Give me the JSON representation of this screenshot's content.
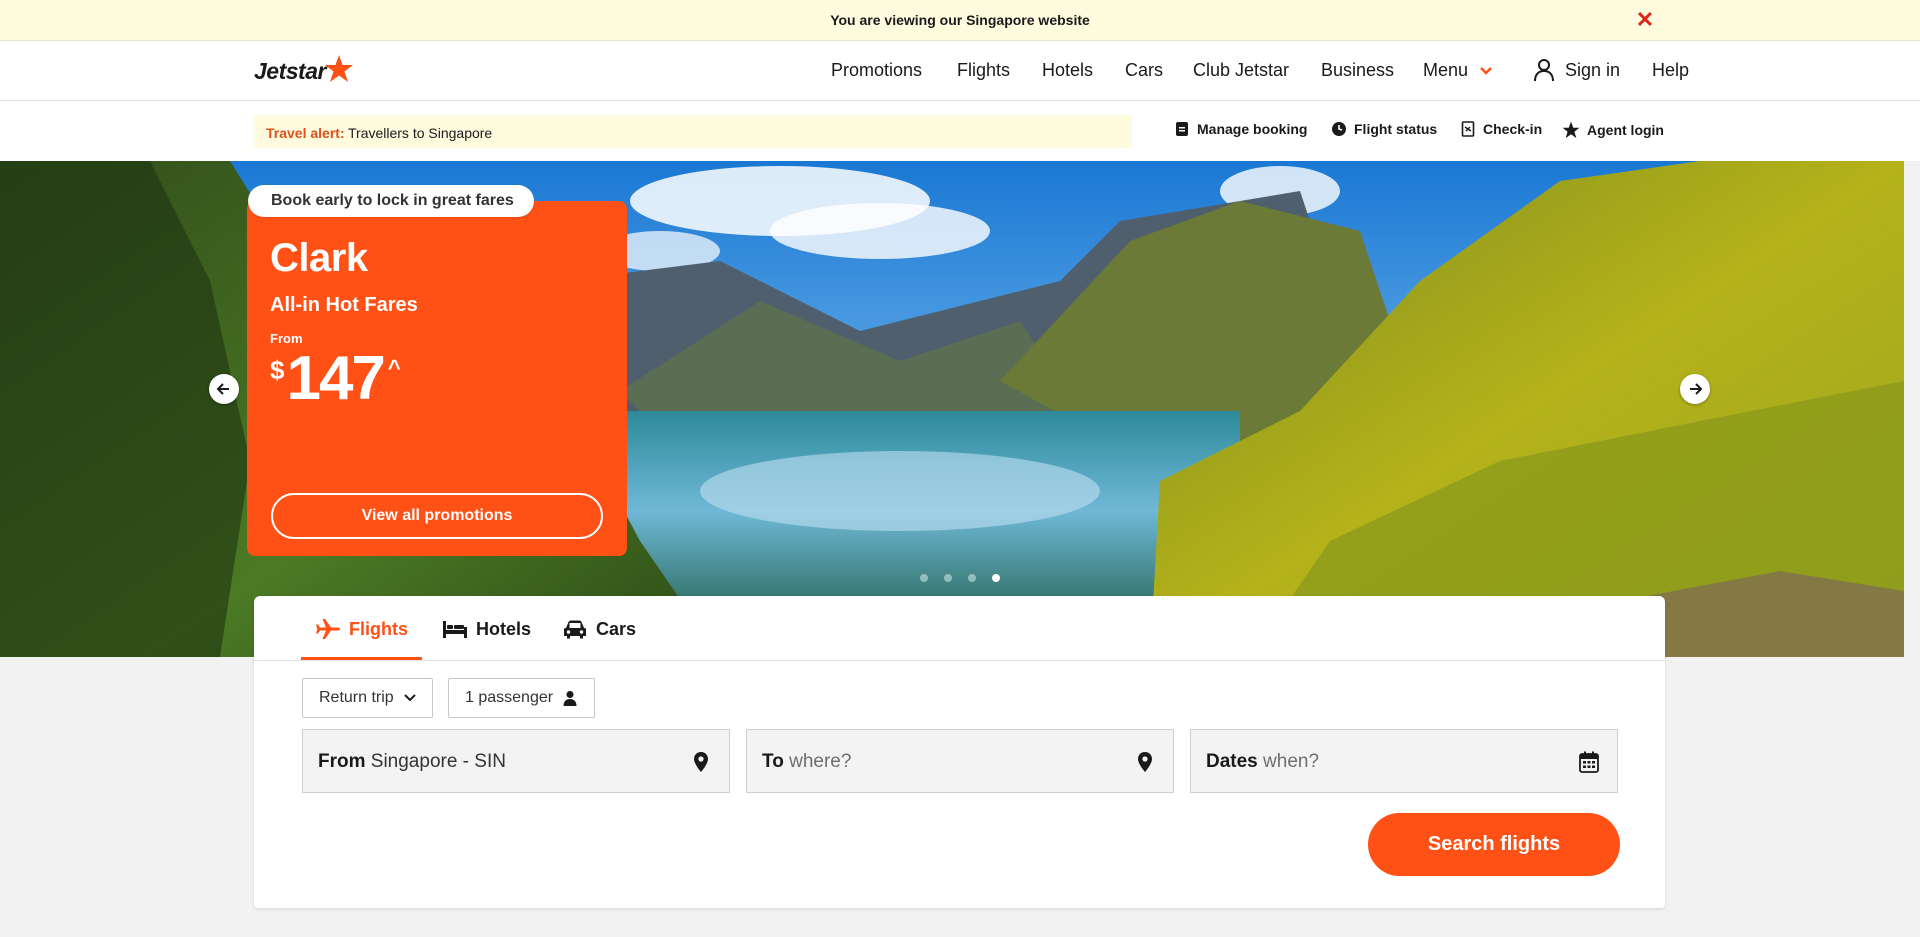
{
  "notice": {
    "text": "You are viewing our Singapore website",
    "close_icon": "close-icon",
    "close_color": "#e0241b"
  },
  "brand": {
    "name": "Jetstar",
    "accent": "#ff5115"
  },
  "nav": {
    "items": [
      "Promotions",
      "Flights",
      "Hotels",
      "Cars",
      "Club Jetstar",
      "Business",
      "Menu"
    ],
    "signin": "Sign in",
    "help": "Help"
  },
  "alert": {
    "label": "Travel alert:",
    "message": "Travellers to Singapore"
  },
  "utility_links": [
    {
      "label": "Manage booking",
      "icon": "document-icon"
    },
    {
      "label": "Flight status",
      "icon": "clock-icon"
    },
    {
      "label": "Check-in",
      "icon": "boarding-pass-icon"
    },
    {
      "label": "Agent login",
      "icon": "star-icon"
    }
  ],
  "hero": {
    "badge": "Book early to lock in great fares",
    "destination": "Clark",
    "subtitle": "All-in Hot Fares",
    "from_label": "From",
    "currency": "$",
    "price": "147",
    "price_suffix": "^",
    "cta": "View all promotions",
    "slide_count": 4,
    "active_slide": 4
  },
  "search": {
    "tabs": [
      {
        "label": "Flights",
        "icon": "plane-icon",
        "active": true
      },
      {
        "label": "Hotels",
        "icon": "bed-icon",
        "active": false
      },
      {
        "label": "Cars",
        "icon": "car-icon",
        "active": false
      }
    ],
    "trip_type": "Return trip",
    "passengers": "1 passenger",
    "from": {
      "label": "From",
      "value": "Singapore - SIN"
    },
    "to": {
      "label": "To",
      "placeholder": "where?"
    },
    "dates": {
      "label": "Dates",
      "placeholder": "when?"
    },
    "submit": "Search flights"
  }
}
